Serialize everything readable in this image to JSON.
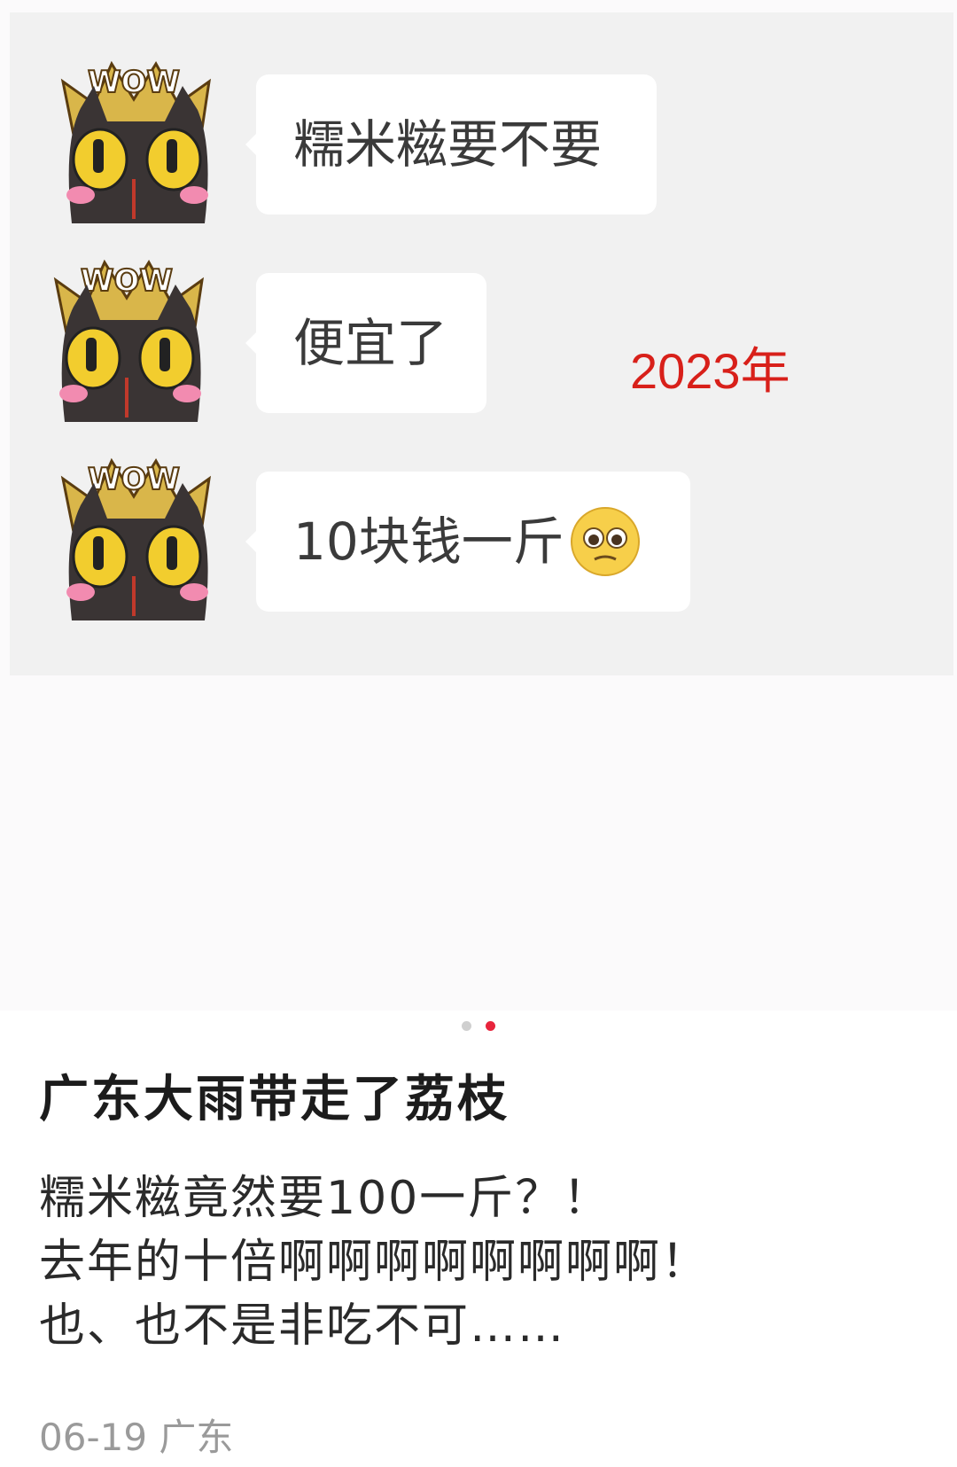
{
  "chat": {
    "messages": [
      {
        "text": "糯米糍要不要",
        "emoji": ""
      },
      {
        "text": "便宜了",
        "emoji": ""
      },
      {
        "text": "10块钱一斤",
        "emoji": "pleading-face-emoji"
      }
    ],
    "avatar": {
      "icon": "black-cat-wow-crown-sticker",
      "crown_text": "WOW"
    },
    "annotation": "2023年"
  },
  "carousel": {
    "total": 2,
    "active_index": 1,
    "active_color": "#e8243c",
    "inactive_color": "#cfcfcf"
  },
  "post": {
    "title": "广东大雨带走了荔枝",
    "body": [
      "糯米糍竟然要100一斤？！",
      "去年的十倍啊啊啊啊啊啊啊啊！",
      "也、也不是非吃不可……"
    ],
    "date": "06-19",
    "location": "广东"
  },
  "colors": {
    "annotation": "#d8201a",
    "chat_background": "#f1f1f1",
    "bubble": "#ffffff"
  }
}
